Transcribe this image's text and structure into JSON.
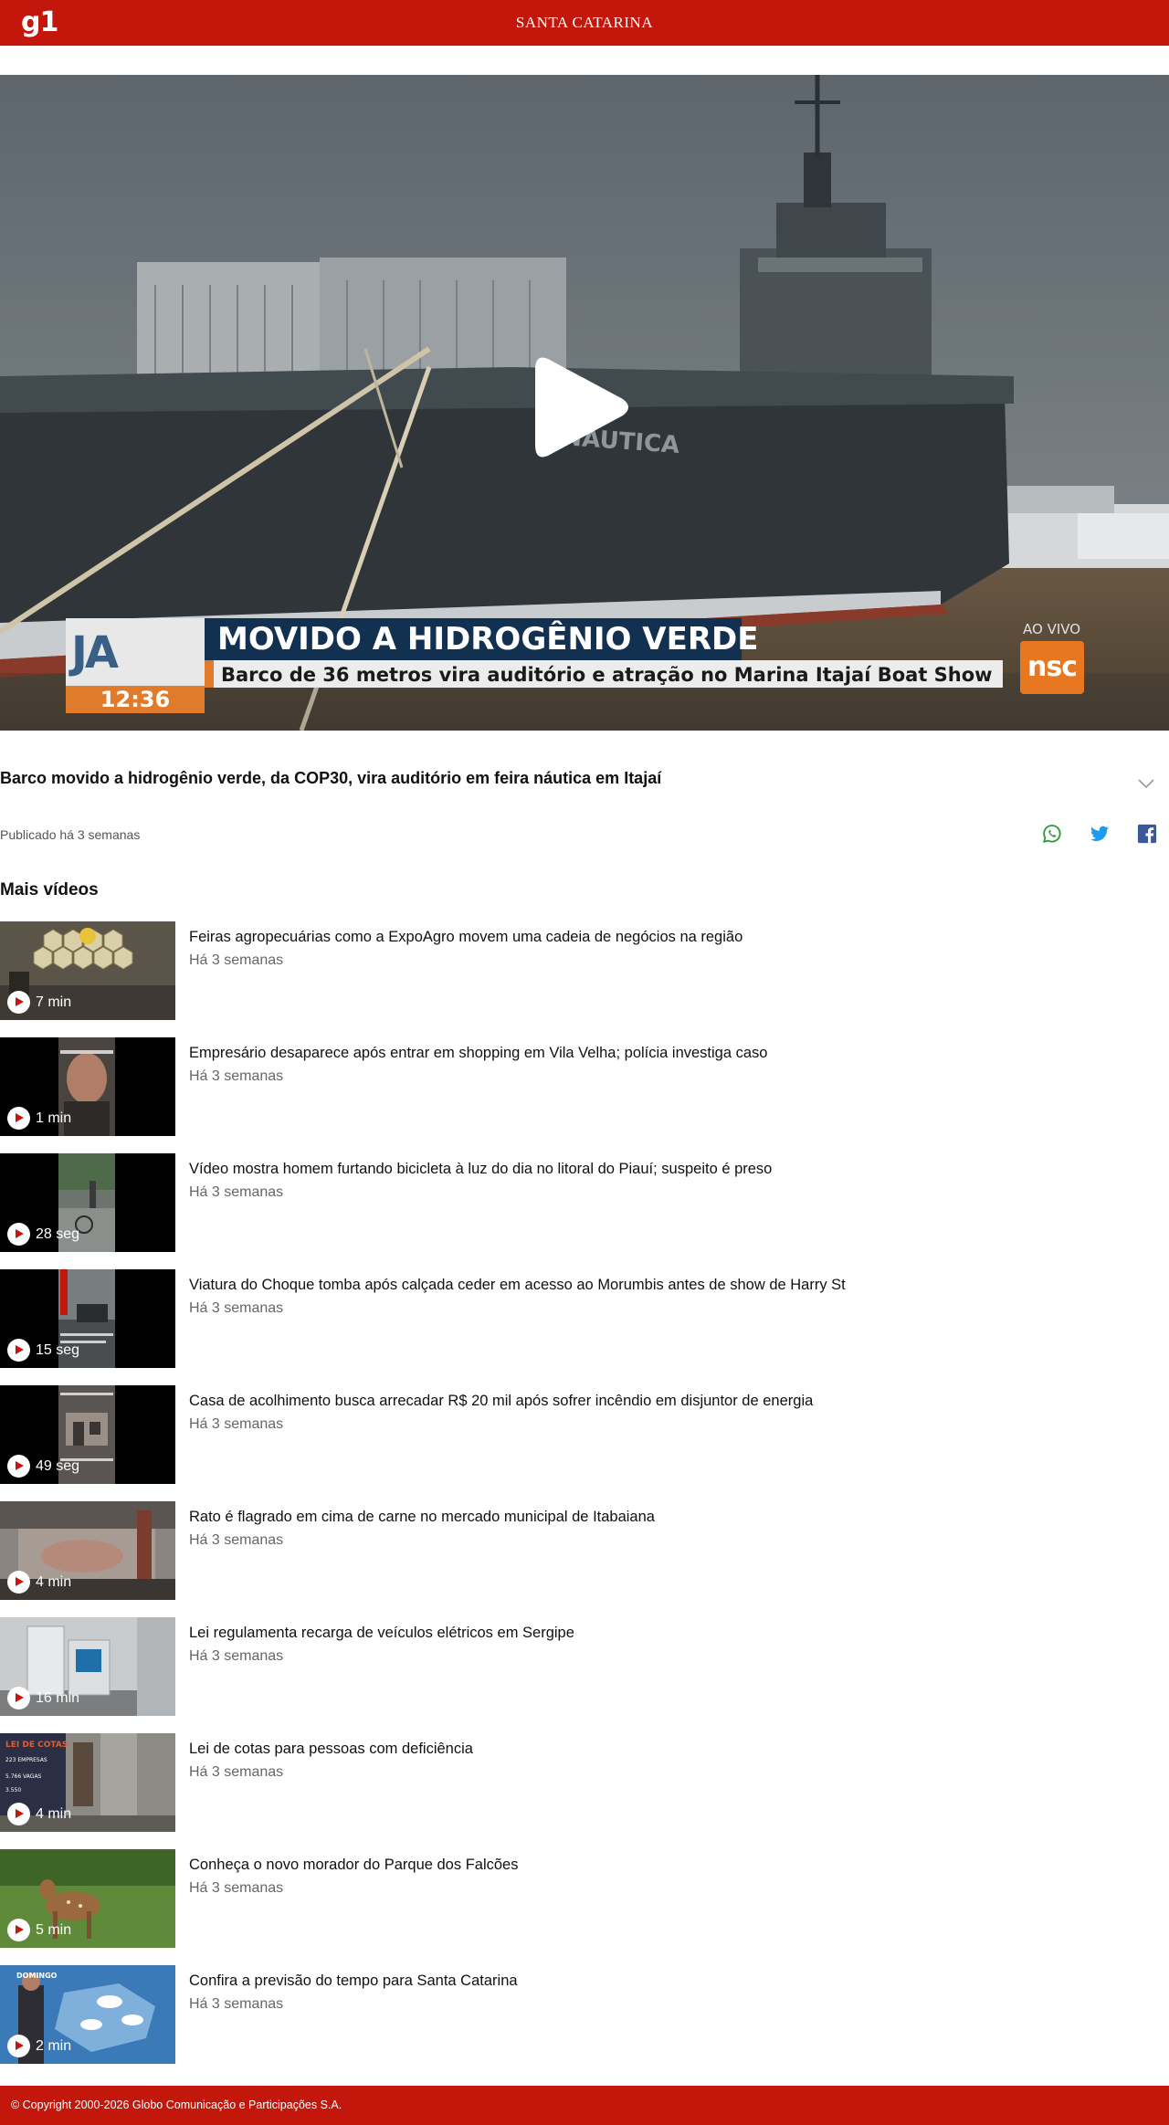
{
  "header": {
    "logo": "g1",
    "region": "SANTA CATARINA"
  },
  "player": {
    "overlay_headline": "MOVIDO A HIDROGÊNIO VERDE",
    "overlay_subtitle": "Barco de 36 metros vira auditório e atração no Marina Itajaí Boat Show",
    "program_logo": "JA",
    "program_time": "12:36",
    "live_label": "AO VIVO",
    "channel_logo": "nsc",
    "hull_text": "NÁUTICA"
  },
  "video": {
    "title": "Barco movido a hidrogênio verde, da COP30, vira auditório em feira náutica em Itajaí",
    "published": "Publicado há 3 semanas"
  },
  "share": {
    "icons": [
      "whatsapp-icon",
      "twitter-icon",
      "facebook-icon"
    ],
    "colors": {
      "whatsapp": "#2a9d3a",
      "twitter": "#1d9bf0",
      "facebook": "#3b5998"
    }
  },
  "more_videos": {
    "heading": "Mais vídeos",
    "items": [
      {
        "title": "Feiras agropecuárias como a ExpoAgro movem uma cadeia de negócios na região",
        "date": "Há 3 semanas",
        "duration": "7 min"
      },
      {
        "title": "Empresário desaparece após entrar em shopping em Vila Velha; polícia investiga caso",
        "date": "Há 3 semanas",
        "duration": "1 min"
      },
      {
        "title": "Vídeo mostra homem furtando bicicleta à luz do dia no litoral do Piauí; suspeito é preso",
        "date": "Há 3 semanas",
        "duration": "28 seg"
      },
      {
        "title": "Viatura do Choque tomba após calçada ceder em acesso ao Morumbis antes de show de Harry St",
        "date": "Há 3 semanas",
        "duration": "15 seg"
      },
      {
        "title": "Casa de acolhimento busca arrecadar R$ 20 mil após sofrer incêndio em disjuntor de energia",
        "date": "Há 3 semanas",
        "duration": "49 seg"
      },
      {
        "title": "Rato é flagrado em cima de carne no mercado municipal de Itabaiana",
        "date": "Há 3 semanas",
        "duration": "4 min"
      },
      {
        "title": "Lei regulamenta recarga de veículos elétricos em Sergipe",
        "date": "Há 3 semanas",
        "duration": "16 min"
      },
      {
        "title": "Lei de cotas para pessoas com deficiência",
        "date": "Há 3 semanas",
        "duration": "4 min"
      },
      {
        "title": "Conheça o novo morador do Parque dos Falcões",
        "date": "Há 3 semanas",
        "duration": "5 min"
      },
      {
        "title": "Confira a previsão do tempo para Santa Catarina",
        "date": "Há 3 semanas",
        "duration": "2 min"
      }
    ]
  },
  "thumb_texts": {
    "cotas_title": "LEI DE COTAS",
    "cotas_line1": "223 EMPRESAS",
    "cotas_line2": "5.766 VAGAS",
    "cotas_line3": "3.550",
    "weather_day": "DOMINGO"
  },
  "footer": {
    "copyright": "© Copyright 2000-2026 Globo Comunicação e Participações S.A."
  },
  "colors": {
    "brand_red": "#c4170c",
    "accent_orange": "#e07b2b"
  }
}
